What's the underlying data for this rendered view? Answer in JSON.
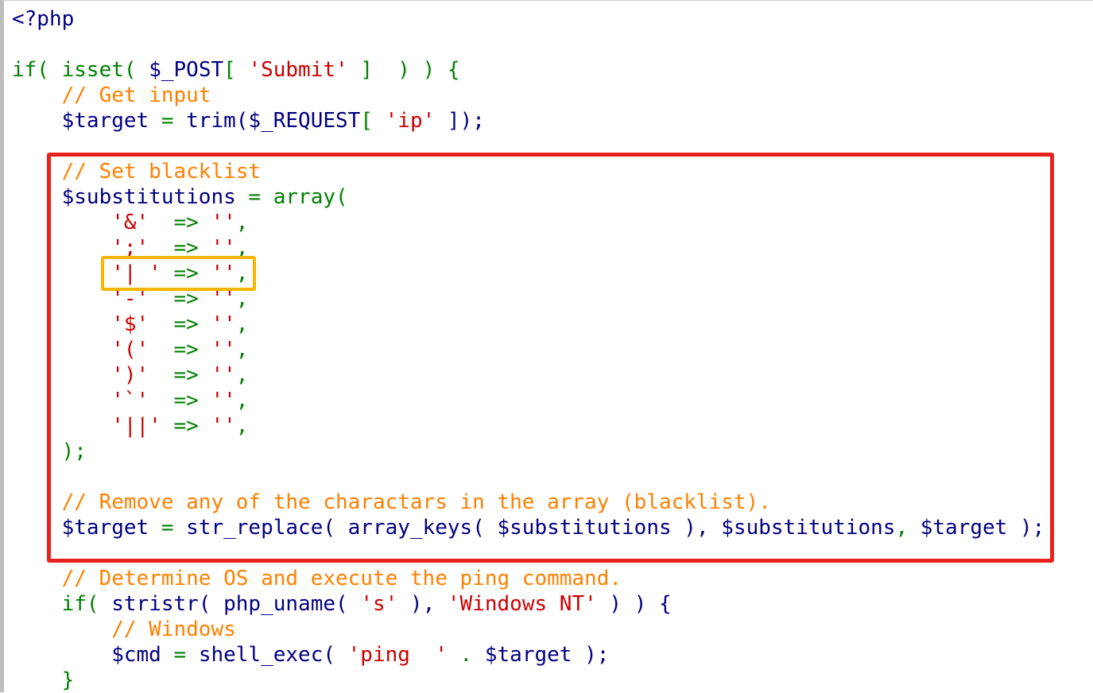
{
  "highlight_colors": {
    "red_box": "#e8231e",
    "yellow_box": "#f7b500"
  },
  "code": {
    "lines": [
      [
        {
          "t": "<?php",
          "c": "punct"
        }
      ],
      [],
      [
        {
          "t": "if( ",
          "c": "kw"
        },
        {
          "t": "isset( ",
          "c": "func"
        },
        {
          "t": "$_POST",
          "c": "var"
        },
        {
          "t": "[ ",
          "c": "op"
        },
        {
          "t": "'Submit'",
          "c": "str"
        },
        {
          "t": " ]  ) ) {",
          "c": "op"
        }
      ],
      [
        {
          "t": "    // Get input",
          "c": "comment"
        }
      ],
      [
        {
          "t": "    $target",
          "c": "var"
        },
        {
          "t": " = ",
          "c": "op"
        },
        {
          "t": "trim(",
          "c": "var"
        },
        {
          "t": "$_REQUEST",
          "c": "var"
        },
        {
          "t": "[ ",
          "c": "op"
        },
        {
          "t": "'ip'",
          "c": "str"
        },
        {
          "t": " ]);",
          "c": "var"
        }
      ],
      [],
      [
        {
          "t": "    // Set blacklist",
          "c": "comment"
        }
      ],
      [
        {
          "t": "    $substitutions",
          "c": "var"
        },
        {
          "t": " = ",
          "c": "op"
        },
        {
          "t": "array(",
          "c": "func"
        }
      ],
      [
        {
          "t": "        '&'",
          "c": "str"
        },
        {
          "t": "  => ",
          "c": "op"
        },
        {
          "t": "''",
          "c": "str"
        },
        {
          "t": ",",
          "c": "op"
        }
      ],
      [
        {
          "t": "        ';'",
          "c": "str"
        },
        {
          "t": "  => ",
          "c": "op"
        },
        {
          "t": "''",
          "c": "str"
        },
        {
          "t": ",",
          "c": "op"
        }
      ],
      [
        {
          "t": "        '| '",
          "c": "str"
        },
        {
          "t": " => ",
          "c": "op"
        },
        {
          "t": "''",
          "c": "str"
        },
        {
          "t": ",",
          "c": "op"
        }
      ],
      [
        {
          "t": "        '-'",
          "c": "str"
        },
        {
          "t": "  => ",
          "c": "op"
        },
        {
          "t": "''",
          "c": "str"
        },
        {
          "t": ",",
          "c": "op"
        }
      ],
      [
        {
          "t": "        '$'",
          "c": "str"
        },
        {
          "t": "  => ",
          "c": "op"
        },
        {
          "t": "''",
          "c": "str"
        },
        {
          "t": ",",
          "c": "op"
        }
      ],
      [
        {
          "t": "        '('",
          "c": "str"
        },
        {
          "t": "  => ",
          "c": "op"
        },
        {
          "t": "''",
          "c": "str"
        },
        {
          "t": ",",
          "c": "op"
        }
      ],
      [
        {
          "t": "        ')'",
          "c": "str"
        },
        {
          "t": "  => ",
          "c": "op"
        },
        {
          "t": "''",
          "c": "str"
        },
        {
          "t": ",",
          "c": "op"
        }
      ],
      [
        {
          "t": "        '`'",
          "c": "str"
        },
        {
          "t": "  => ",
          "c": "op"
        },
        {
          "t": "''",
          "c": "str"
        },
        {
          "t": ",",
          "c": "op"
        }
      ],
      [
        {
          "t": "        '||'",
          "c": "str"
        },
        {
          "t": " => ",
          "c": "op"
        },
        {
          "t": "''",
          "c": "str"
        },
        {
          "t": ",",
          "c": "op"
        }
      ],
      [
        {
          "t": "    );",
          "c": "kw"
        }
      ],
      [],
      [
        {
          "t": "    // Remove any of the charactars in the array (blacklist).",
          "c": "comment"
        }
      ],
      [
        {
          "t": "    $target",
          "c": "var"
        },
        {
          "t": " = ",
          "c": "op"
        },
        {
          "t": "str_replace( ",
          "c": "var"
        },
        {
          "t": "array_keys( ",
          "c": "var"
        },
        {
          "t": "$substitutions",
          "c": "var"
        },
        {
          "t": " ), ",
          "c": "var"
        },
        {
          "t": "$substitutions",
          "c": "var"
        },
        {
          "t": ", ",
          "c": "op"
        },
        {
          "t": "$target",
          "c": "var"
        },
        {
          "t": " );",
          "c": "var"
        }
      ],
      [],
      [
        {
          "t": "    // Determine OS and execute the ping command.",
          "c": "comment"
        }
      ],
      [
        {
          "t": "    if( ",
          "c": "kw"
        },
        {
          "t": "stristr( ",
          "c": "var"
        },
        {
          "t": "php_uname( ",
          "c": "var"
        },
        {
          "t": "'s'",
          "c": "str"
        },
        {
          "t": " ), ",
          "c": "var"
        },
        {
          "t": "'Windows NT'",
          "c": "str"
        },
        {
          "t": " ) ) {",
          "c": "var"
        }
      ],
      [
        {
          "t": "        // Windows",
          "c": "comment"
        }
      ],
      [
        {
          "t": "        $cmd",
          "c": "var"
        },
        {
          "t": " = ",
          "c": "op"
        },
        {
          "t": "shell_exec( ",
          "c": "var"
        },
        {
          "t": "'ping  '",
          "c": "str"
        },
        {
          "t": " . ",
          "c": "op"
        },
        {
          "t": "$target",
          "c": "var"
        },
        {
          "t": " );",
          "c": "var"
        }
      ],
      [
        {
          "t": "    }",
          "c": "kw"
        }
      ]
    ]
  }
}
